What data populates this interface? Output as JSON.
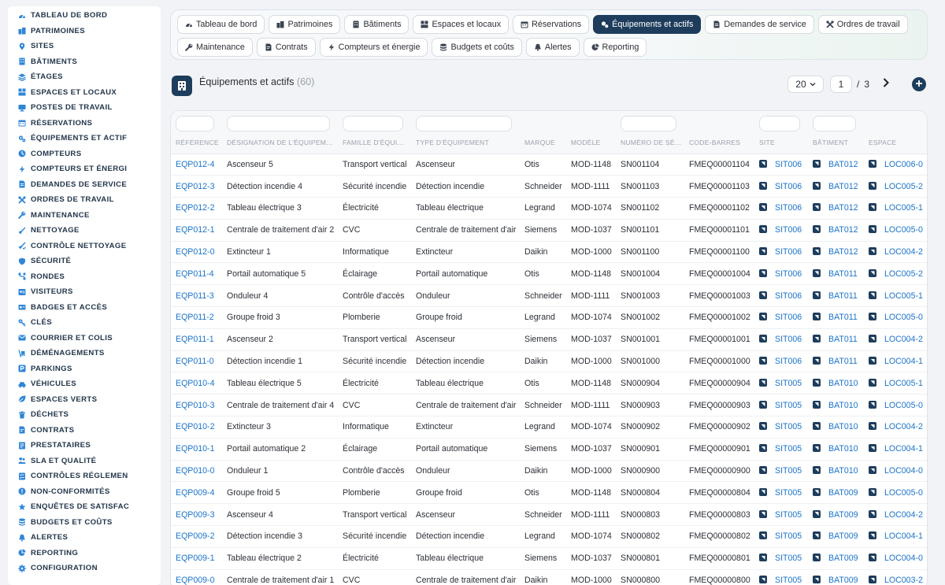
{
  "sidebar": {
    "items": [
      {
        "label": "TABLEAU DE BORD",
        "icon": "gauge-icon"
      },
      {
        "label": "PATRIMOINES",
        "icon": "buildings-icon"
      },
      {
        "label": "SITES",
        "icon": "map-pin-icon"
      },
      {
        "label": "BÂTIMENTS",
        "icon": "building-icon"
      },
      {
        "label": "ÉTAGES",
        "icon": "layers-icon"
      },
      {
        "label": "ESPACES ET LOCAUX",
        "icon": "spaces-icon"
      },
      {
        "label": "POSTES DE TRAVAIL",
        "icon": "monitor-icon"
      },
      {
        "label": "RÉSERVATIONS",
        "icon": "calendar-icon"
      },
      {
        "label": "ÉQUIPEMENTS ET ACTIF",
        "icon": "gears-icon"
      },
      {
        "label": "COMPTEURS",
        "icon": "counter-icon"
      },
      {
        "label": "COMPTEURS ET ÉNERGI",
        "icon": "bolt-icon"
      },
      {
        "label": "DEMANDES DE SERVICE",
        "icon": "document-icon"
      },
      {
        "label": "ORDRES DE TRAVAIL",
        "icon": "tools-icon"
      },
      {
        "label": "MAINTENANCE",
        "icon": "wrench-icon"
      },
      {
        "label": "NETTOYAGE",
        "icon": "broom-icon"
      },
      {
        "label": "CONTRÔLE NETTOYAGE",
        "icon": "broom-check-icon"
      },
      {
        "label": "SÉCURITÉ",
        "icon": "shield-icon"
      },
      {
        "label": "RONDES",
        "icon": "route-icon"
      },
      {
        "label": "VISITEURS",
        "icon": "visitor-icon"
      },
      {
        "label": "BADGES ET ACCÈS",
        "icon": "badge-icon"
      },
      {
        "label": "CLÉS",
        "icon": "key-icon"
      },
      {
        "label": "COURRIER ET COLIS",
        "icon": "mail-icon"
      },
      {
        "label": "DÉMÉNAGEMENTS",
        "icon": "dolly-icon"
      },
      {
        "label": "PARKINGS",
        "icon": "parking-icon"
      },
      {
        "label": "VÉHICULES",
        "icon": "car-icon"
      },
      {
        "label": "ESPACES VERTS",
        "icon": "leaf-icon"
      },
      {
        "label": "DÉCHETS",
        "icon": "trash-icon"
      },
      {
        "label": "CONTRATS",
        "icon": "contract-icon"
      },
      {
        "label": "PRESTATAIRES",
        "icon": "vendor-icon"
      },
      {
        "label": "SLA ET QUALITÉ",
        "icon": "people-icon"
      },
      {
        "label": "CONTRÔLES RÉGLEMEN",
        "icon": "checklist-icon"
      },
      {
        "label": "NON-CONFORMITÉS",
        "icon": "alert-circle-icon"
      },
      {
        "label": "ENQUÊTES DE SATISFAC",
        "icon": "star-icon"
      },
      {
        "label": "BUDGETS ET COÛTS",
        "icon": "money-icon"
      },
      {
        "label": "ALERTES",
        "icon": "bell-icon"
      },
      {
        "label": "REPORTING",
        "icon": "chart-pie-icon"
      },
      {
        "label": "CONFIGURATION",
        "icon": "settings-icon"
      }
    ]
  },
  "tabs": {
    "row1": [
      {
        "label": "Tableau de bord",
        "icon": "gauge-icon"
      },
      {
        "label": "Patrimoines",
        "icon": "buildings-icon"
      },
      {
        "label": "Bâtiments",
        "icon": "building-icon"
      },
      {
        "label": "Espaces et locaux",
        "icon": "spaces-icon"
      },
      {
        "label": "Réservations",
        "icon": "calendar-icon"
      },
      {
        "label": "Équipements et actifs",
        "icon": "gears-icon",
        "active": true
      },
      {
        "label": "Demandes de service",
        "icon": "document-icon"
      },
      {
        "label": "Ordres de travail",
        "icon": "tools-icon"
      }
    ],
    "row2": [
      {
        "label": "Maintenance",
        "icon": "wrench-icon"
      },
      {
        "label": "Contrats",
        "icon": "contract-icon"
      },
      {
        "label": "Compteurs et énergie",
        "icon": "bolt-icon"
      },
      {
        "label": "Budgets et coûts",
        "icon": "money-icon"
      },
      {
        "label": "Alertes",
        "icon": "bell-icon"
      },
      {
        "label": "Reporting",
        "icon": "chart-pie-icon"
      }
    ]
  },
  "header": {
    "title": "Équipements et actifs",
    "count": "(60)",
    "page_size": "20",
    "current_page": "1",
    "page_sep": "/",
    "total_pages": "3"
  },
  "table": {
    "columns": [
      "RÉFÉRENCE",
      "DÉSIGNATION DE L'ÉQUIPEM…",
      "FAMILLE D'ÉQUI…",
      "TYPE D'ÉQUIPEMENT",
      "MARQUE",
      "MODÈLE",
      "NUMÉRO DE SÉ…",
      "CODE-BARRES",
      "SITE",
      "BÂTIMENT",
      "ESPACE"
    ],
    "rows": [
      [
        "EQP012-4",
        "Ascenseur 5",
        "Transport vertical",
        "Ascenseur",
        "Otis",
        "MOD-1148",
        "SN001104",
        "FMEQ00001104",
        "SIT006",
        "BAT012",
        "LOC006-0"
      ],
      [
        "EQP012-3",
        "Détection incendie 4",
        "Sécurité incendie",
        "Détection incendie",
        "Schneider",
        "MOD-1111",
        "SN001103",
        "FMEQ00001103",
        "SIT006",
        "BAT012",
        "LOC005-2"
      ],
      [
        "EQP012-2",
        "Tableau électrique 3",
        "Électricité",
        "Tableau électrique",
        "Legrand",
        "MOD-1074",
        "SN001102",
        "FMEQ00001102",
        "SIT006",
        "BAT012",
        "LOC005-1"
      ],
      [
        "EQP012-1",
        "Centrale de traitement d'air 2",
        "CVC",
        "Centrale de traitement d'air",
        "Siemens",
        "MOD-1037",
        "SN001101",
        "FMEQ00001101",
        "SIT006",
        "BAT012",
        "LOC005-0"
      ],
      [
        "EQP012-0",
        "Extincteur 1",
        "Informatique",
        "Extincteur",
        "Daikin",
        "MOD-1000",
        "SN001100",
        "FMEQ00001100",
        "SIT006",
        "BAT012",
        "LOC004-2"
      ],
      [
        "EQP011-4",
        "Portail automatique 5",
        "Éclairage",
        "Portail automatique",
        "Otis",
        "MOD-1148",
        "SN001004",
        "FMEQ00001004",
        "SIT006",
        "BAT011",
        "LOC005-2"
      ],
      [
        "EQP011-3",
        "Onduleur 4",
        "Contrôle d'accès",
        "Onduleur",
        "Schneider",
        "MOD-1111",
        "SN001003",
        "FMEQ00001003",
        "SIT006",
        "BAT011",
        "LOC005-1"
      ],
      [
        "EQP011-2",
        "Groupe froid 3",
        "Plomberie",
        "Groupe froid",
        "Legrand",
        "MOD-1074",
        "SN001002",
        "FMEQ00001002",
        "SIT006",
        "BAT011",
        "LOC005-0"
      ],
      [
        "EQP011-1",
        "Ascenseur 2",
        "Transport vertical",
        "Ascenseur",
        "Siemens",
        "MOD-1037",
        "SN001001",
        "FMEQ00001001",
        "SIT006",
        "BAT011",
        "LOC004-2"
      ],
      [
        "EQP011-0",
        "Détection incendie 1",
        "Sécurité incendie",
        "Détection incendie",
        "Daikin",
        "MOD-1000",
        "SN001000",
        "FMEQ00001000",
        "SIT006",
        "BAT011",
        "LOC004-1"
      ],
      [
        "EQP010-4",
        "Tableau électrique 5",
        "Électricité",
        "Tableau électrique",
        "Otis",
        "MOD-1148",
        "SN000904",
        "FMEQ00000904",
        "SIT005",
        "BAT010",
        "LOC005-1"
      ],
      [
        "EQP010-3",
        "Centrale de traitement d'air 4",
        "CVC",
        "Centrale de traitement d'air",
        "Schneider",
        "MOD-1111",
        "SN000903",
        "FMEQ00000903",
        "SIT005",
        "BAT010",
        "LOC005-0"
      ],
      [
        "EQP010-2",
        "Extincteur 3",
        "Informatique",
        "Extincteur",
        "Legrand",
        "MOD-1074",
        "SN000902",
        "FMEQ00000902",
        "SIT005",
        "BAT010",
        "LOC004-2"
      ],
      [
        "EQP010-1",
        "Portail automatique 2",
        "Éclairage",
        "Portail automatique",
        "Siemens",
        "MOD-1037",
        "SN000901",
        "FMEQ00000901",
        "SIT005",
        "BAT010",
        "LOC004-1"
      ],
      [
        "EQP010-0",
        "Onduleur 1",
        "Contrôle d'accès",
        "Onduleur",
        "Daikin",
        "MOD-1000",
        "SN000900",
        "FMEQ00000900",
        "SIT005",
        "BAT010",
        "LOC004-0"
      ],
      [
        "EQP009-4",
        "Groupe froid 5",
        "Plomberie",
        "Groupe froid",
        "Otis",
        "MOD-1148",
        "SN000804",
        "FMEQ00000804",
        "SIT005",
        "BAT009",
        "LOC005-0"
      ],
      [
        "EQP009-3",
        "Ascenseur 4",
        "Transport vertical",
        "Ascenseur",
        "Schneider",
        "MOD-1111",
        "SN000803",
        "FMEQ00000803",
        "SIT005",
        "BAT009",
        "LOC004-2"
      ],
      [
        "EQP009-2",
        "Détection incendie 3",
        "Sécurité incendie",
        "Détection incendie",
        "Legrand",
        "MOD-1074",
        "SN000802",
        "FMEQ00000802",
        "SIT005",
        "BAT009",
        "LOC004-1"
      ],
      [
        "EQP009-1",
        "Tableau électrique 2",
        "Électricité",
        "Tableau électrique",
        "Siemens",
        "MOD-1037",
        "SN000801",
        "FMEQ00000801",
        "SIT005",
        "BAT009",
        "LOC004-0"
      ],
      [
        "EQP009-0",
        "Centrale de traitement d'air 1",
        "CVC",
        "Centrale de traitement d'air",
        "Daikin",
        "MOD-1000",
        "SN000800",
        "FMEQ00000800",
        "SIT005",
        "BAT009",
        "LOC003-2"
      ]
    ]
  },
  "colors": {
    "primary": "#1e3d5c",
    "link": "#1a73c8",
    "sidebar_icon": "#2f86d8"
  }
}
